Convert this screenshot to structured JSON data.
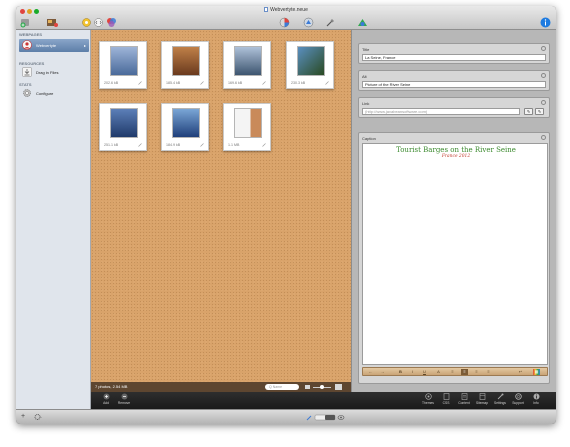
{
  "window": {
    "title": "Webvertyte.neue"
  },
  "sidebar": {
    "sections": [
      {
        "heading": "WEBPAGES",
        "items": [
          {
            "label": "Webvertyte",
            "count": "▸",
            "icon": "page-avatar-icon",
            "selected": true
          }
        ]
      },
      {
        "heading": "RESOURCES",
        "items": [
          {
            "label": "Drag in Files",
            "icon": "download-tray-icon",
            "selected": false
          }
        ]
      },
      {
        "heading": "STATS",
        "items": [
          {
            "label": "Configure",
            "icon": "gear-icon",
            "selected": false
          }
        ]
      }
    ]
  },
  "gallery": {
    "photos": [
      {
        "size": "202.6 kB",
        "thumb_colors": [
          "#9db4d8",
          "#4a6a9a"
        ]
      },
      {
        "size": "185.4 kB",
        "thumb_colors": [
          "#c08048",
          "#6a3a1e"
        ]
      },
      {
        "size": "169.6 kB",
        "thumb_colors": [
          "#aec1d9",
          "#3d556f"
        ]
      },
      {
        "size": "230.3 kB",
        "thumb_colors": [
          "#5a8fc0",
          "#2a4a22"
        ]
      },
      {
        "size": "251.1 kB",
        "thumb_colors": [
          "#5c7fb8",
          "#203a6a"
        ]
      },
      {
        "size": "184.9 kB",
        "thumb_colors": [
          "#7aa6d6",
          "#1f3f7a"
        ]
      },
      {
        "size": "1.1 MB",
        "thumb_colors": [
          "#f4f4f4",
          "#c98a5a"
        ]
      }
    ],
    "status": "7 photos, 2.54 MB",
    "search_placeholder": "Q Name"
  },
  "inspector": {
    "title": {
      "label": "Title",
      "value": "La Seine, France"
    },
    "alt": {
      "label": "Alt",
      "value": "Picture of the River Seine"
    },
    "link": {
      "label": "Link",
      "placeholder": "(http://www.javabeansoftware.com)"
    },
    "caption": {
      "label": "Caption",
      "heading": "Tourist Barges on the River Seine",
      "subheading": "France 2012",
      "heading_color": "#3b8a2e",
      "subheading_color": "#c0392b"
    },
    "format_buttons": [
      "←",
      "→",
      "B",
      "I",
      "U",
      "A",
      "≡",
      "≡",
      "≡",
      "≡",
      "↩",
      "▦"
    ]
  },
  "bottombar": {
    "left": [
      {
        "label": "Add",
        "icon": "plus-circle-icon"
      },
      {
        "label": "Remove",
        "icon": "minus-circle-icon"
      }
    ],
    "right": [
      {
        "label": "Themes",
        "icon": "themes-icon"
      },
      {
        "label": "CSS",
        "icon": "css-icon"
      },
      {
        "label": "Content",
        "icon": "content-icon"
      },
      {
        "label": "Sitemap",
        "icon": "sitemap-icon"
      },
      {
        "label": "Settings",
        "icon": "settings-icon"
      },
      {
        "label": "Support",
        "icon": "support-icon"
      },
      {
        "label": "Info",
        "icon": "info-icon"
      }
    ]
  },
  "colors": {
    "board": "#d9a36a",
    "accent": "#5d7ea8",
    "info": "#1e7be0"
  }
}
